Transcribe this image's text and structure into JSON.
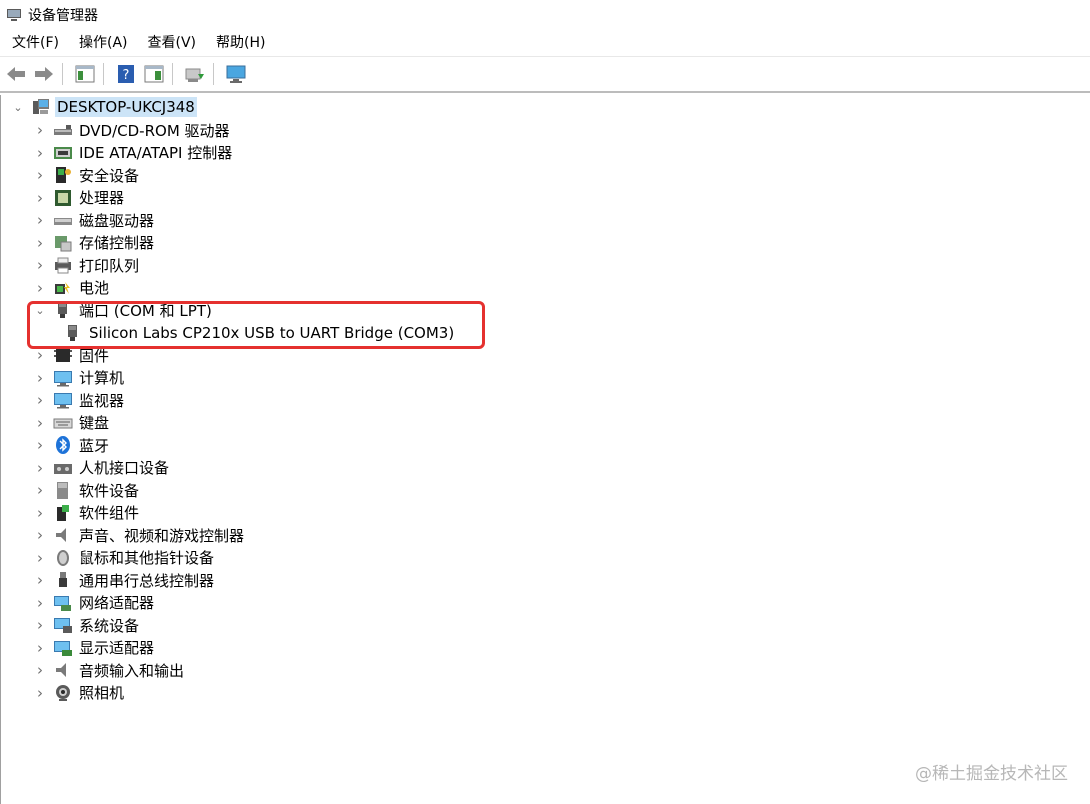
{
  "window": {
    "title": "设备管理器"
  },
  "menu": [
    {
      "label": "文件(F)"
    },
    {
      "label": "操作(A)"
    },
    {
      "label": "查看(V)"
    },
    {
      "label": "帮助(H)"
    }
  ],
  "tree": {
    "root": {
      "label": "DESKTOP-UKCJ348",
      "icon": "computer-icon",
      "expanded": true
    },
    "items": [
      {
        "label": "DVD/CD-ROM 驱动器",
        "icon": "dvd-drive-icon"
      },
      {
        "label": "IDE ATA/ATAPI 控制器",
        "icon": "ide-controller-icon"
      },
      {
        "label": "安全设备",
        "icon": "security-device-icon"
      },
      {
        "label": "处理器",
        "icon": "processor-icon"
      },
      {
        "label": "磁盘驱动器",
        "icon": "disk-drive-icon"
      },
      {
        "label": "存储控制器",
        "icon": "storage-controller-icon"
      },
      {
        "label": "打印队列",
        "icon": "printer-icon"
      },
      {
        "label": "电池",
        "icon": "battery-icon"
      },
      {
        "label": "端口 (COM 和 LPT)",
        "icon": "port-icon",
        "expanded": true
      },
      {
        "label": "Silicon Labs CP210x USB to UART Bridge (COM3)",
        "icon": "port-icon",
        "child": true
      },
      {
        "label": "固件",
        "icon": "firmware-icon"
      },
      {
        "label": "计算机",
        "icon": "monitor-icon"
      },
      {
        "label": "监视器",
        "icon": "monitor-icon"
      },
      {
        "label": "键盘",
        "icon": "keyboard-icon"
      },
      {
        "label": "蓝牙",
        "icon": "bluetooth-icon"
      },
      {
        "label": "人机接口设备",
        "icon": "hid-icon"
      },
      {
        "label": "软件设备",
        "icon": "software-device-icon"
      },
      {
        "label": "软件组件",
        "icon": "software-component-icon"
      },
      {
        "label": "声音、视频和游戏控制器",
        "icon": "speaker-icon"
      },
      {
        "label": "鼠标和其他指针设备",
        "icon": "mouse-icon"
      },
      {
        "label": "通用串行总线控制器",
        "icon": "usb-icon"
      },
      {
        "label": "网络适配器",
        "icon": "network-adapter-icon"
      },
      {
        "label": "系统设备",
        "icon": "system-device-icon"
      },
      {
        "label": "显示适配器",
        "icon": "display-adapter-icon"
      },
      {
        "label": "音频输入和输出",
        "icon": "audio-icon"
      },
      {
        "label": "照相机",
        "icon": "camera-icon"
      }
    ]
  },
  "watermark": "@稀土掘金技术社区",
  "colors": {
    "highlight": "#e5312f",
    "selection": "#cce4f7"
  }
}
